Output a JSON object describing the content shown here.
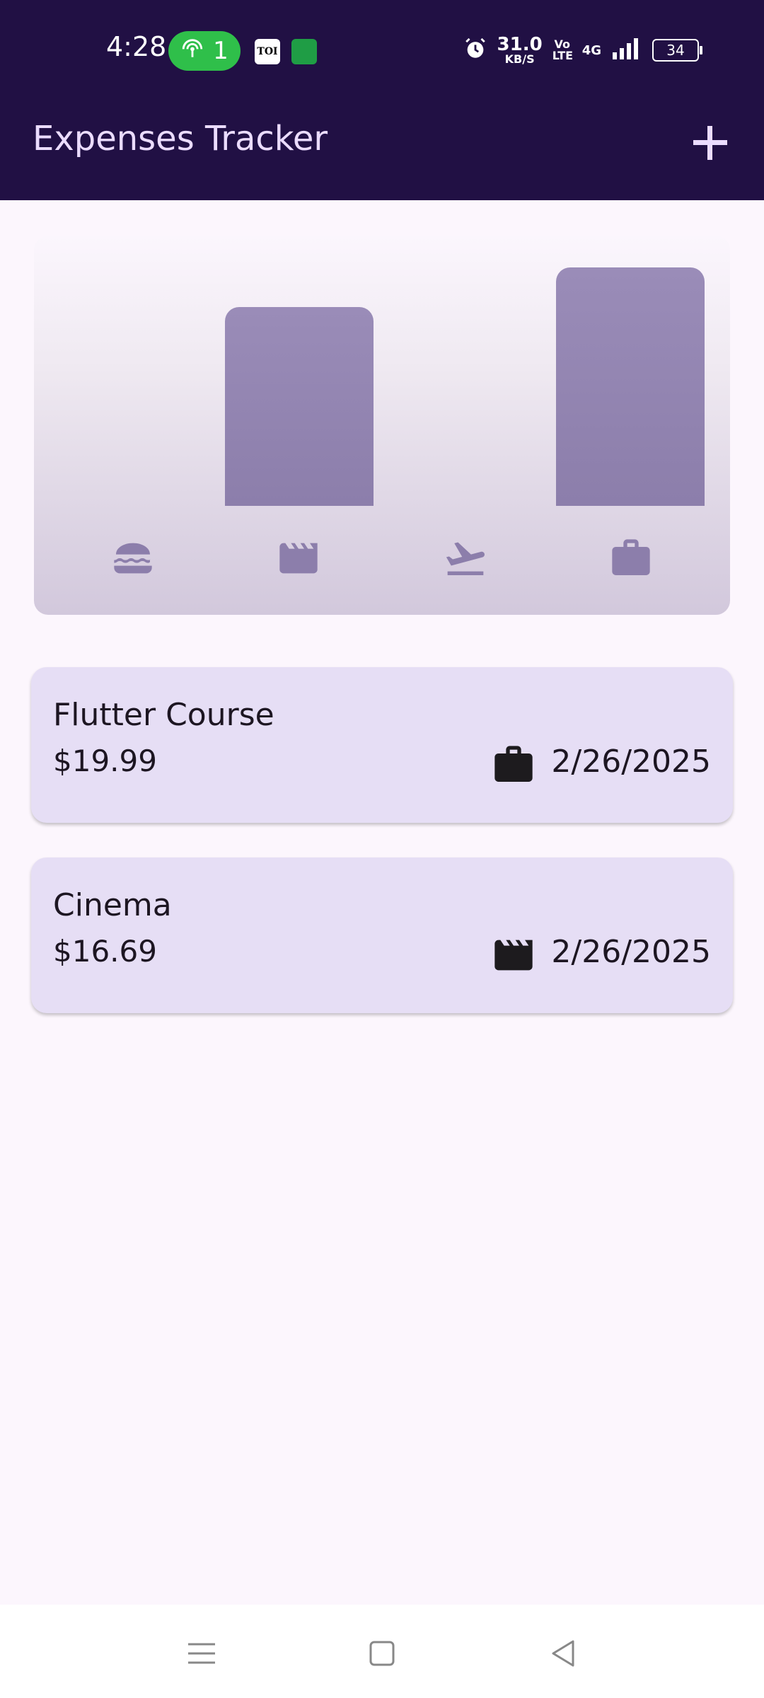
{
  "status_bar": {
    "time": "4:28",
    "hotspot_count": "1",
    "toi_label": "TOI",
    "net_speed_value": "31.0",
    "net_speed_unit": "KB/S",
    "volte": "Vo LTE",
    "network": "4G",
    "battery": "34",
    "icons": [
      "hotspot-icon",
      "toi-app-icon",
      "store-app-icon",
      "alarm-icon",
      "signal-icon",
      "battery-icon"
    ]
  },
  "app_bar": {
    "title": "Expenses Tracker",
    "add_icon": "plus-icon"
  },
  "chart_data": {
    "type": "bar",
    "categories": [
      "food",
      "leisure",
      "travel",
      "work"
    ],
    "category_icons": [
      "hamburger-icon",
      "clapperboard-icon",
      "flight-takeoff-icon",
      "briefcase-icon"
    ],
    "values": [
      0,
      16.69,
      0,
      19.99
    ]
  },
  "expenses": [
    {
      "title": "Flutter Course",
      "amount": "$19.99",
      "category_icon": "briefcase-icon",
      "date": "2/26/2025"
    },
    {
      "title": "Cinema",
      "amount": "$16.69",
      "category_icon": "clapperboard-icon",
      "date": "2/26/2025"
    }
  ],
  "nav_bar": {
    "icons": [
      "menu-icon",
      "home-square-icon",
      "back-triangle-icon"
    ]
  },
  "colors": {
    "app_bar": "#211044",
    "background": "#fcf6fd",
    "card": "#e6def5",
    "bar": "#9486b2",
    "title_text": "#ebdcff"
  }
}
